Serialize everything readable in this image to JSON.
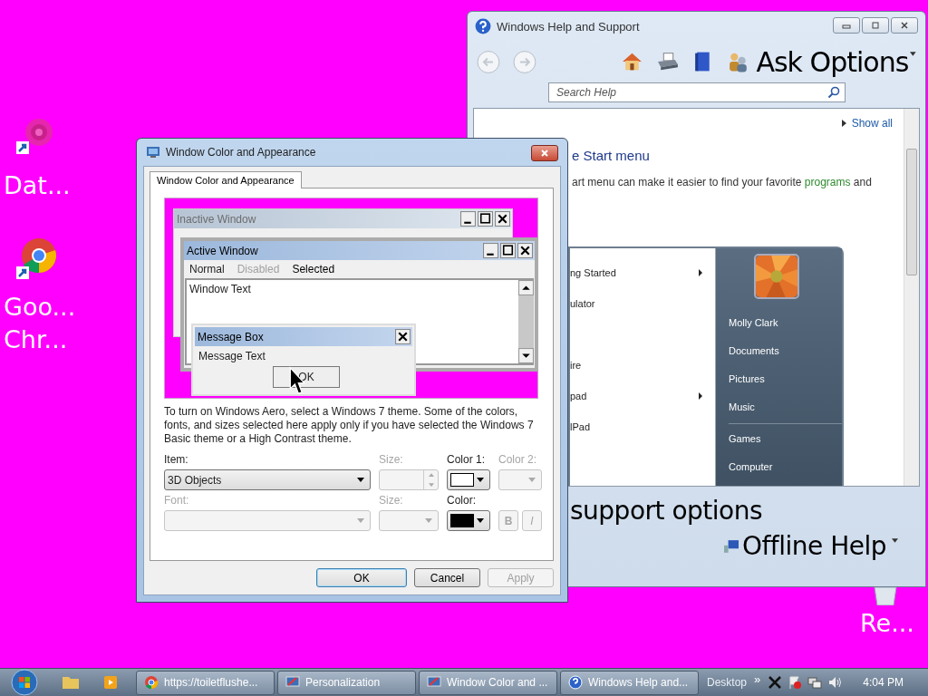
{
  "desktop": {
    "icons": [
      {
        "kind": "flower-shortcut",
        "labels": [
          "Dat..."
        ]
      },
      {
        "kind": "browser-shortcut",
        "labels": [
          "Goo...",
          "Chr..."
        ]
      }
    ],
    "recycle_bin": {
      "label": "Re..."
    }
  },
  "help_window": {
    "title": "Windows Help and Support",
    "ask_label": "Ask Options",
    "search": {
      "placeholder": "Search Help"
    },
    "show_all": "Show all",
    "heading": "e Start menu",
    "paragraph": "art menu can make it easier to find your favorite **programs** and",
    "start_menu": {
      "left_items": [
        {
          "label": "ng Started",
          "submenu": true
        },
        {
          "label": "ulator",
          "submenu": false
        },
        {
          "label": "ire",
          "submenu": false
        },
        {
          "label": "pad",
          "submenu": true
        },
        {
          "label": "lPad",
          "submenu": false
        }
      ],
      "right_items": [
        {
          "label": "Molly Clark",
          "separator_before": false
        },
        {
          "label": "Documents",
          "separator_before": false
        },
        {
          "label": "Pictures",
          "separator_before": false
        },
        {
          "label": "Music",
          "separator_before": false
        },
        {
          "label": "Games",
          "separator_before": true
        },
        {
          "label": "Computer",
          "separator_before": false
        }
      ]
    },
    "support_label": "support options",
    "offline_label": "Offline Help"
  },
  "dialog": {
    "title": "Window Color and Appearance",
    "tabs": [
      {
        "label": "Window Color and Appearance",
        "selected": true
      }
    ],
    "preview": {
      "inactive_title": "Inactive Window",
      "active_title": "Active Window",
      "menu": [
        {
          "label": "Normal",
          "kind": "normal"
        },
        {
          "label": "Disabled",
          "kind": "disabled"
        },
        {
          "label": "Selected",
          "kind": "selected"
        }
      ],
      "window_text": "Window Text",
      "message_title": "Message Box",
      "message_text": "Message Text",
      "message_button": "OK"
    },
    "note": "To turn on Windows Aero, select a Windows 7 theme.  Some of the colors, fonts, and sizes selected here apply only if you have selected the Windows 7 Basic theme or a High Contrast theme.",
    "fields": [
      {
        "kind": "dropdown",
        "label": "Item:",
        "value": "3D Objects",
        "disabled": false
      },
      {
        "kind": "spinner",
        "label": "Size:",
        "disabled": true
      },
      {
        "kind": "color",
        "label": "Color 1:",
        "color": "#ffffff",
        "disabled": false
      },
      {
        "kind": "dropdown",
        "label": "Color 2:",
        "disabled": true
      },
      {
        "kind": "dropdown",
        "label": "Font:",
        "disabled": true
      },
      {
        "kind": "dropdown",
        "label": "Size:",
        "disabled": true
      },
      {
        "kind": "color",
        "label": "Color:",
        "color": "#000000",
        "disabled": false
      },
      {
        "kind": "style-buttons",
        "buttons": [
          "B",
          "I"
        ],
        "disabled": true
      }
    ],
    "buttons": [
      {
        "label": "OK",
        "kind": "default",
        "disabled": false
      },
      {
        "label": "Cancel",
        "kind": "normal",
        "disabled": false
      },
      {
        "label": "Apply",
        "kind": "normal",
        "disabled": true
      }
    ]
  },
  "taskbar": {
    "buttons": [
      {
        "label": "https://toiletflushe...",
        "kind": "browser"
      },
      {
        "label": "Personalization",
        "kind": "display"
      },
      {
        "label": "Window Color and ...",
        "kind": "display"
      },
      {
        "label": "Windows Help and...",
        "kind": "help"
      }
    ],
    "toolbar_label": "Desktop",
    "chevron": "»",
    "clock": "4:04 PM"
  }
}
